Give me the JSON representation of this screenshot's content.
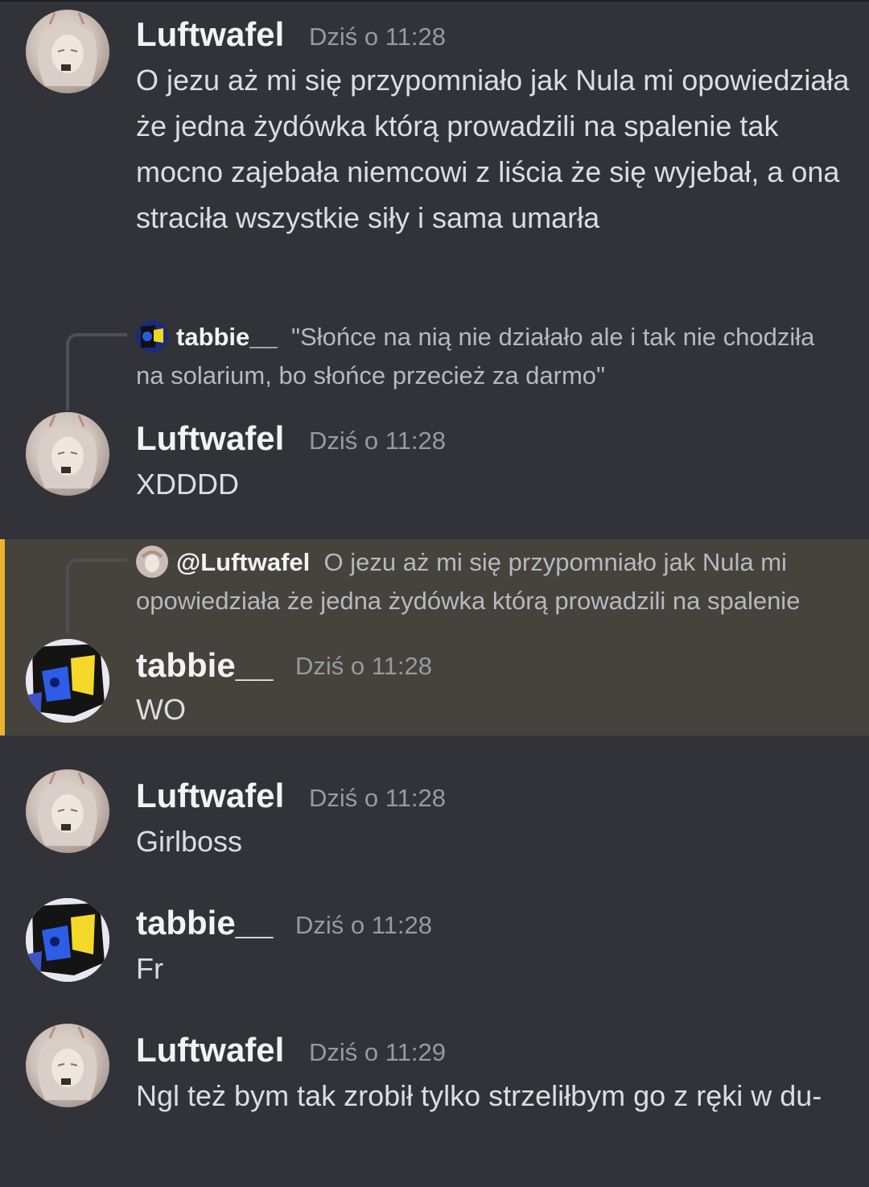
{
  "messages": [
    {
      "author": "Luftwafel",
      "time": "Dziś o 11:28",
      "text": "O jezu aż mi się przypomniało jak Nula mi opowiedziała że jedna żydówka którą prowadzili na spalenie tak mocno zajebała niemcowi z liścia że się wyjebał, a ona straciła wszystkie siły i sama umarła"
    },
    {
      "reply": {
        "author": "tabbie__",
        "text": "\"Słońce na nią nie działało ale i tak nie chodziła na solarium, bo słońce przecież za darmo\""
      },
      "author": "Luftwafel",
      "time": "Dziś o 11:28",
      "text": "XDDDD"
    },
    {
      "reply": {
        "author": "@Luftwafel",
        "text": "O jezu aż mi się przypomniało jak Nula mi opowiedziała że jedna żydówka którą prowadzili na spalenie"
      },
      "author": "tabbie__",
      "time": "Dziś o 11:28",
      "text": "WO",
      "highlighted": true
    },
    {
      "author": "Luftwafel",
      "time": "Dziś o 11:28",
      "text": "Girlboss"
    },
    {
      "author": "tabbie__",
      "time": "Dziś o 11:28",
      "text": "Fr"
    },
    {
      "author": "Luftwafel",
      "time": "Dziś o 11:29",
      "text": "Ngl też bym tak zrobił tylko strzeliłbym go z ręki w du-"
    }
  ],
  "colors": {
    "background": "#313338",
    "highlight": "#46433c",
    "highlight_bar": "#f0b232",
    "username": "#f2f3f5",
    "timestamp": "#949ba4",
    "text": "#dbdee1"
  }
}
